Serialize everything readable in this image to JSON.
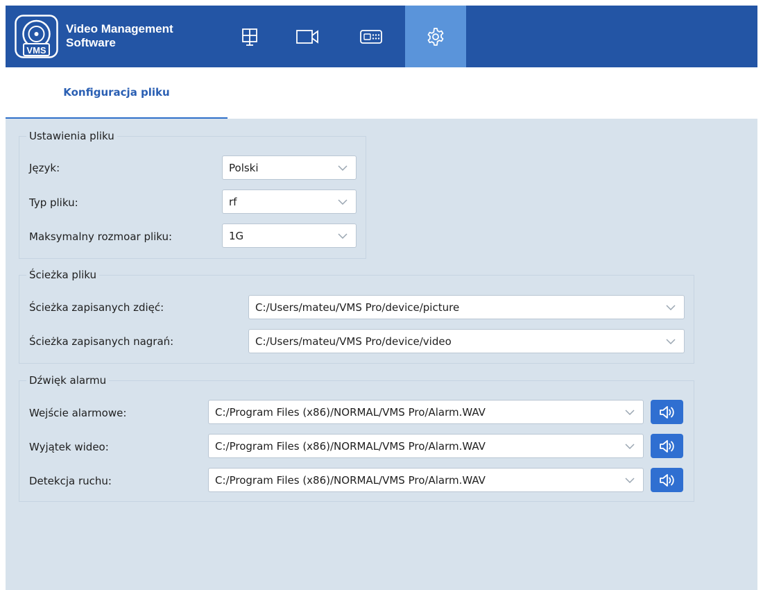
{
  "app": {
    "title_line1": "Video Management",
    "title_line2": "Software",
    "logo_text": "VMS"
  },
  "nav": {
    "items": [
      {
        "icon": "grid-layout-icon"
      },
      {
        "icon": "camera-icon"
      },
      {
        "icon": "recorder-device-icon"
      },
      {
        "icon": "gear-icon",
        "active": true
      }
    ]
  },
  "tabs": [
    {
      "label": "Konfiguracja pliku",
      "active": true
    }
  ],
  "file_settings": {
    "title": "Ustawienia pliku",
    "language_label": "Język:",
    "language_value": "Polski",
    "file_type_label": "Typ pliku:",
    "file_type_value": "rf",
    "max_size_label": "Maksymalny rozmoar pliku:",
    "max_size_value": "1G"
  },
  "file_path": {
    "title": "Ścieżka pliku",
    "pictures_label": "Ścieżka zapisanych zdięć:",
    "pictures_value": "C:/Users/mateu/VMS Pro/device/picture",
    "recordings_label": "Ścieżka zapisanych nagrań:",
    "recordings_value": "C:/Users/mateu/VMS Pro/device/video"
  },
  "alarm_sound": {
    "title": "Dźwięk alarmu",
    "rows": [
      {
        "label": "Wejście alarmowe:",
        "value": "C:/Program Files (x86)/NORMAL/VMS Pro/Alarm.WAV"
      },
      {
        "label": "Wyjątek wideo:",
        "value": "C:/Program Files (x86)/NORMAL/VMS Pro/Alarm.WAV"
      },
      {
        "label": "Detekcja ruchu:",
        "value": "C:/Program Files (x86)/NORMAL/VMS Pro/Alarm.WAV"
      }
    ]
  },
  "colors": {
    "header": "#2355a5",
    "active_nav": "#5a94da",
    "accent": "#2e6fc9",
    "panel": "#d7e2ec",
    "sound_button": "#2f6fd1"
  }
}
